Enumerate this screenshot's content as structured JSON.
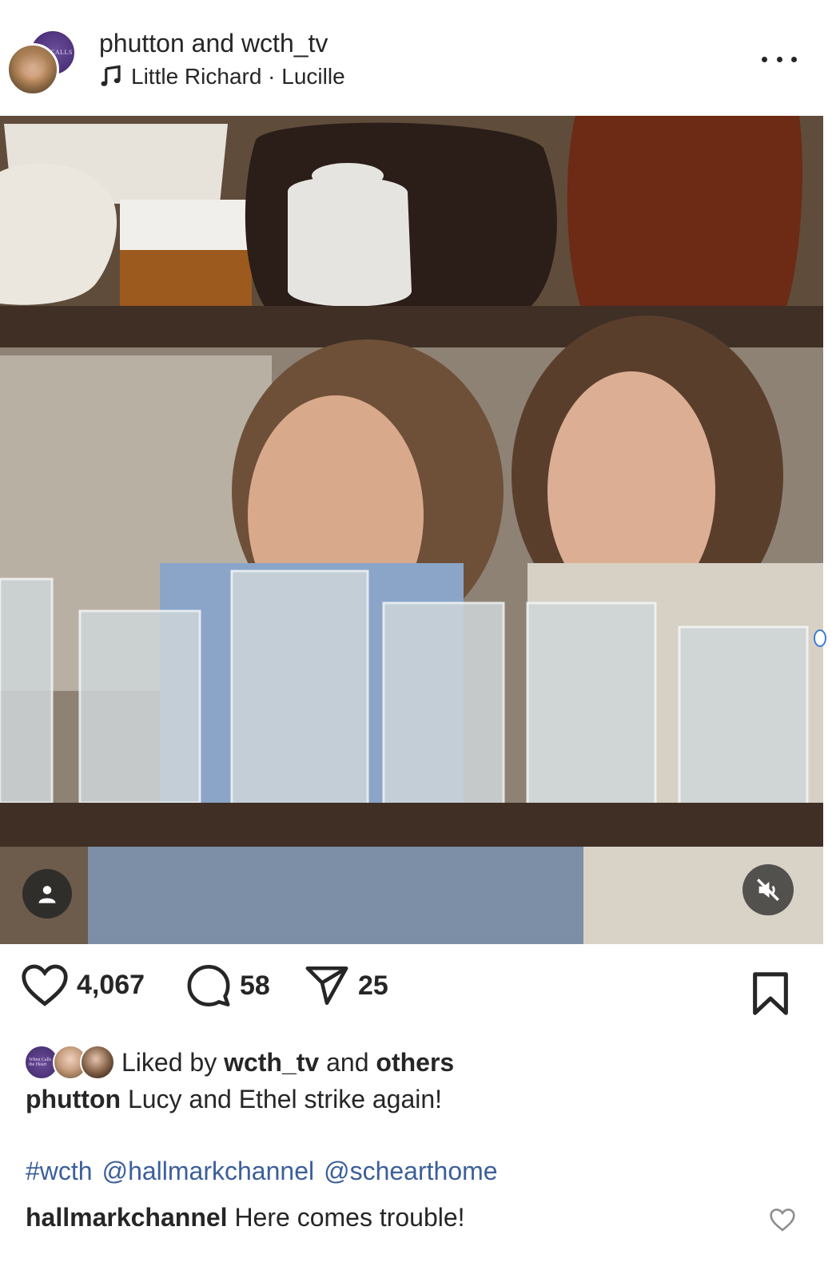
{
  "post": {
    "authors": "phutton and wcth_tv",
    "audio": "Little Richard · Lucille",
    "avatar_back_text": "CALLS"
  },
  "actions": {
    "likes": "4,067",
    "comments": "58",
    "shares": "25"
  },
  "liked_by": {
    "prefix": "Liked by",
    "user": "wcth_tv",
    "middle": "and",
    "others": "others",
    "mini_avatar_text": "When Calls the Heart"
  },
  "caption": {
    "user": "phutton",
    "text": "Lucy and Ethel strike again!"
  },
  "hashtags": [
    "#wcth",
    "@hallmarkchannel",
    "@schearthome"
  ],
  "comment": {
    "user": "hallmarkchannel",
    "text": "Here comes trouble!"
  },
  "colors": {
    "text": "#262626",
    "link": "#3c5f9a",
    "brand_purple": "#4a2f78"
  },
  "icons": [
    "music-note-icon",
    "more-icon",
    "heart-icon",
    "comment-icon",
    "share-icon",
    "bookmark-icon",
    "user-tag-icon",
    "mute-icon"
  ]
}
